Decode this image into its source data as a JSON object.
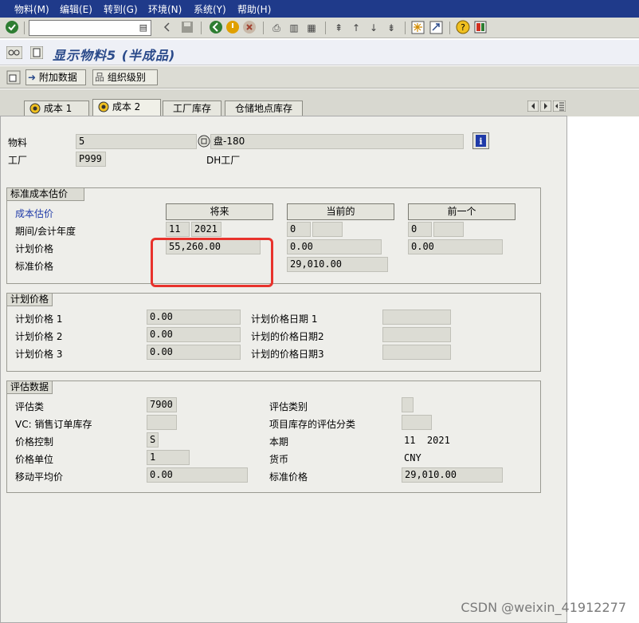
{
  "menu": [
    "物料(M)",
    "编辑(E)",
    "转到(G)",
    "环境(N)",
    "系统(Y)",
    "帮助(H)"
  ],
  "title": "显示物料5 (半成品)",
  "app_toolbar": {
    "additional_data": "附加数据",
    "org_levels": "组织级别"
  },
  "tabs": [
    "成本 1",
    "成本 2",
    "工厂库存",
    "仓储地点库存"
  ],
  "header": {
    "material_label": "物料",
    "material_value": "5",
    "material_desc": "盘-180",
    "plant_label": "工厂",
    "plant_value": "P999",
    "plant_desc": "DH工厂"
  },
  "std_cost": {
    "title": "标准成本估价",
    "cost_estimate_label": "成本估价",
    "buttons": [
      "将来",
      "当前的",
      "前一个"
    ],
    "period_label": "期间/会计年度",
    "future": {
      "period": "11",
      "year": "2021",
      "planned": "55,260.00"
    },
    "current": {
      "period": "0",
      "year": "",
      "planned": "0.00",
      "standard": "29,010.00"
    },
    "previous": {
      "period": "0",
      "year": "",
      "planned": "0.00"
    },
    "planned_label": "计划价格",
    "standard_label": "标准价格"
  },
  "planned_prices": {
    "title": "计划价格",
    "rows": [
      {
        "label": "计划价格 1",
        "value": "0.00",
        "date_label": "计划价格日期 1",
        "date": ""
      },
      {
        "label": "计划价格 2",
        "value": "0.00",
        "date_label": "计划的价格日期2",
        "date": ""
      },
      {
        "label": "计划价格 3",
        "value": "0.00",
        "date_label": "计划的价格日期3",
        "date": ""
      }
    ]
  },
  "valuation": {
    "title": "评估数据",
    "val_class_label": "评估类",
    "val_class": "7900",
    "val_category_label": "评估类别",
    "val_category": "",
    "vc_label": "VC: 销售订单库存",
    "vc": "",
    "proj_label": "项目库存的评估分类",
    "proj": "",
    "price_ctrl_label": "价格控制",
    "price_ctrl": "S",
    "cur_period_label": "本期",
    "cur_period": "11  2021",
    "price_unit_label": "价格单位",
    "price_unit": "1",
    "currency_label": "货币",
    "currency": "CNY",
    "mov_avg_label": "移动平均价",
    "mov_avg": "0.00",
    "std_price_label": "标准价格",
    "std_price": "29,010.00"
  },
  "watermark": "CSDN @weixin_41912277"
}
